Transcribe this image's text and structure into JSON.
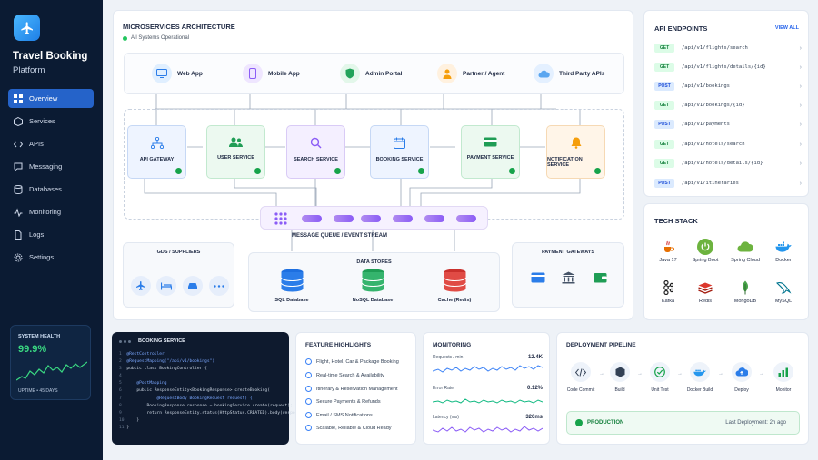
{
  "brand": {
    "name": "Travel Booking",
    "sub": "Platform"
  },
  "nav": [
    "Overview",
    "Services",
    "APIs",
    "Messaging",
    "Databases",
    "Monitoring",
    "Logs",
    "Settings"
  ],
  "health": {
    "title": "SYSTEM HEALTH",
    "value": "99.9%",
    "uptime": "UPTIME • 45 DAYS"
  },
  "arch": {
    "title": "MICROSERVICES ARCHITECTURE",
    "status": "All Systems Operational",
    "clients": [
      "Web App",
      "Mobile App",
      "Admin Portal",
      "Partner / Agent",
      "Third Party APIs"
    ],
    "services": [
      "API GATEWAY",
      "USER SERVICE",
      "SEARCH SERVICE",
      "BOOKING SERVICE",
      "PAYMENT SERVICE",
      "NOTIFICATION SERVICE"
    ],
    "mq": "MESSAGE QUEUE / EVENT STREAM",
    "gds": "GDS / SUPPLIERS",
    "stores": "DATA STORES",
    "dbs": [
      "SQL Database",
      "NoSQL Database",
      "Cache (Redis)"
    ],
    "payments": "PAYMENT GATEWAYS"
  },
  "api": {
    "title": "API ENDPOINTS",
    "viewall": "VIEW ALL",
    "endpoints": [
      {
        "method": "GET",
        "path": "/api/v1/flights/search"
      },
      {
        "method": "GET",
        "path": "/api/v1/flights/details/{id}"
      },
      {
        "method": "POST",
        "path": "/api/v1/bookings"
      },
      {
        "method": "GET",
        "path": "/api/v1/bookings/{id}"
      },
      {
        "method": "POST",
        "path": "/api/v1/payments"
      },
      {
        "method": "GET",
        "path": "/api/v1/hotels/search"
      },
      {
        "method": "GET",
        "path": "/api/v1/hotels/details/{id}"
      },
      {
        "method": "POST",
        "path": "/api/v1/itineraries"
      }
    ]
  },
  "tech": {
    "title": "TECH STACK",
    "items": [
      "Java 17",
      "Spring Boot",
      "Spring Cloud",
      "Docker",
      "Kafka",
      "Redis",
      "MongoDB",
      "MySQL"
    ]
  },
  "code": {
    "title": "BOOKING SERVICE",
    "lines": [
      "@RestController",
      "@RequestMapping(\"/api/v1/bookings\")",
      "public class BookingController {",
      "",
      "    @PostMapping",
      "    public ResponseEntity<BookingResponse> createBooking(",
      "            @RequestBody BookingRequest request) {",
      "        BookingResponse response = bookingService.create(request);",
      "        return ResponseEntity.status(HttpStatus.CREATED).body(response);",
      "    }",
      "}"
    ]
  },
  "features": {
    "title": "FEATURE HIGHLIGHTS",
    "items": [
      "Flight, Hotel, Car & Package Booking",
      "Real-time Search & Availability",
      "Itinerary & Reservation Management",
      "Secure Payments & Refunds",
      "Email / SMS Notifications",
      "Scalable, Reliable & Cloud Ready"
    ]
  },
  "monitoring": {
    "title": "MONITORING",
    "metrics": [
      {
        "label": "Requests / min",
        "value": "12.4K"
      },
      {
        "label": "Error Rate",
        "value": "0.12%"
      },
      {
        "label": "Latency (ms)",
        "value": "320ms"
      }
    ]
  },
  "deploy": {
    "title": "DEPLOYMENT PIPELINE",
    "steps": [
      "Code Commit",
      "Build",
      "Unit Test",
      "Docker Build",
      "Deploy",
      "Monitor"
    ],
    "env": "PRODUCTION",
    "last": "Last Deployment: 2h ago"
  },
  "colors": {
    "primary": "#2563c9",
    "sidebar": "#0b1b33",
    "success": "#16a34a",
    "queue": "#8b5cf6"
  }
}
